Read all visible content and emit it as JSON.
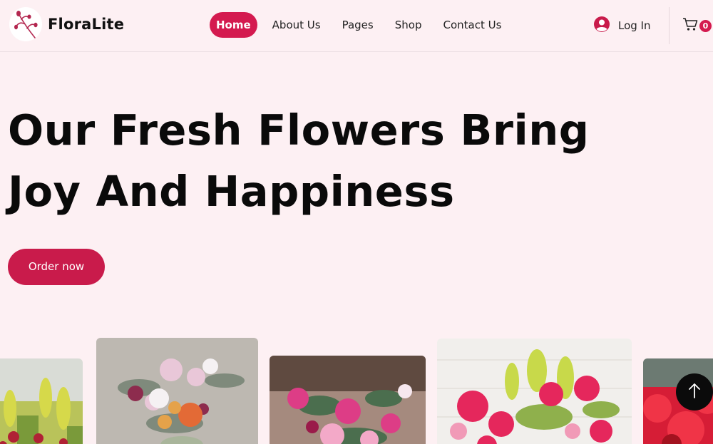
{
  "brand": {
    "name": "FloraLite",
    "logo_icon": "flower-branch-icon"
  },
  "nav": {
    "items": [
      {
        "label": "Home",
        "active": true
      },
      {
        "label": "About Us",
        "active": false
      },
      {
        "label": "Pages",
        "active": false
      },
      {
        "label": "Shop",
        "active": false
      },
      {
        "label": "Contact Us",
        "active": false
      }
    ]
  },
  "header_actions": {
    "login_label": "Log In",
    "login_icon": "user-avatar-icon",
    "cart_icon": "shopping-cart-icon",
    "cart_count": "0"
  },
  "hero": {
    "title_line_1": "Our Fresh Flowers Bring",
    "title_line_2": "Joy And Happiness",
    "cta_label": "Order now"
  },
  "gallery": {
    "images": [
      {
        "subject": "yellow and red flowers",
        "icon": "bouquet-image"
      },
      {
        "subject": "pink dahlias and orange blooms bouquet",
        "icon": "bouquet-image"
      },
      {
        "subject": "pink roses and eucalyptus bouquet",
        "icon": "bouquet-image"
      },
      {
        "subject": "pink flowers with green leaves",
        "icon": "bouquet-image"
      },
      {
        "subject": "red flowers",
        "icon": "bouquet-image"
      }
    ]
  },
  "scroll_top_icon": "arrow-up-icon",
  "colors": {
    "accent": "#d41a4f",
    "background": "#fdf0f3",
    "text": "#0b0b0b"
  }
}
